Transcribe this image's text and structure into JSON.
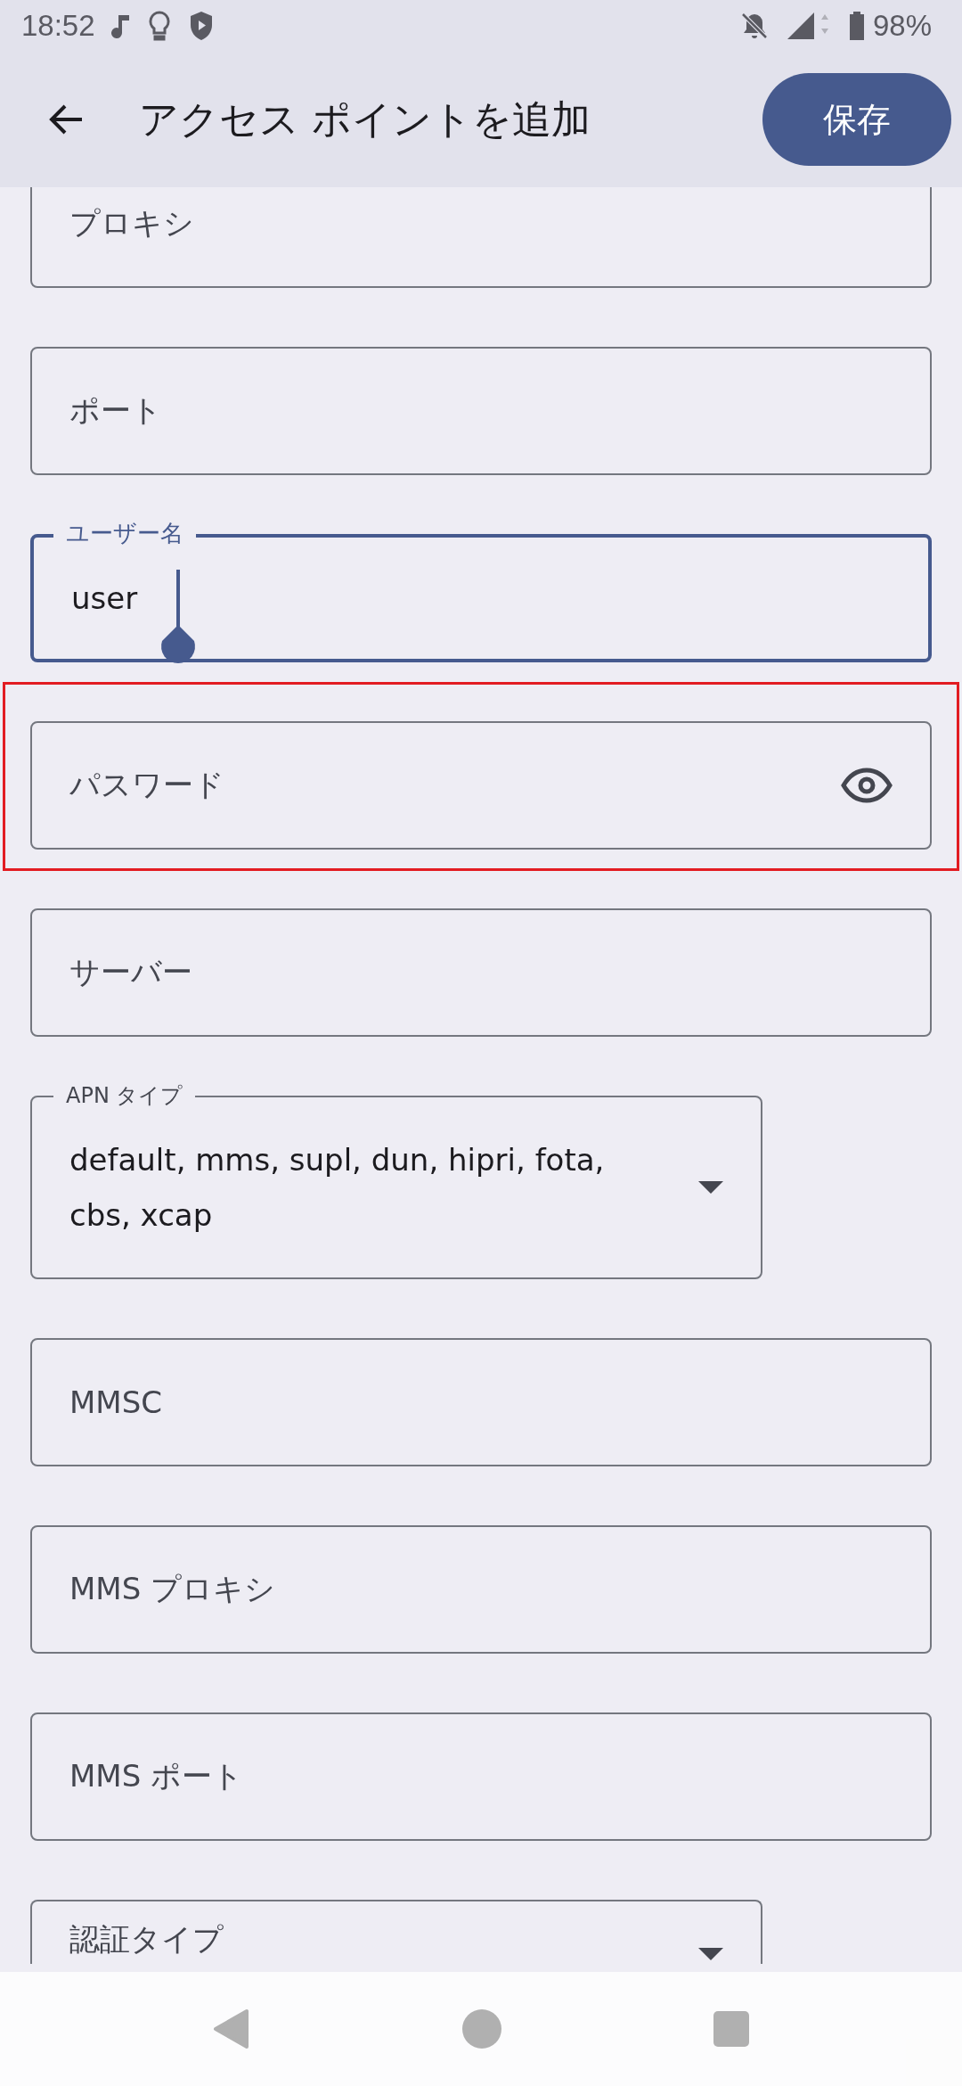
{
  "status_bar": {
    "time": "18:52",
    "battery": "98%"
  },
  "app_bar": {
    "title": "アクセス ポイントを追加",
    "save": "保存"
  },
  "fields": [
    {
      "kind": "text",
      "placeholder": "プロキシ",
      "focused": false,
      "highlighted": false
    },
    {
      "kind": "text",
      "placeholder": "ポート",
      "focused": false,
      "highlighted": false
    },
    {
      "kind": "text",
      "label": "ユーザー名",
      "value": "user",
      "focused": true,
      "highlighted": false
    },
    {
      "kind": "password",
      "placeholder": "パスワード",
      "focused": false,
      "highlighted": true
    },
    {
      "kind": "text",
      "placeholder": "サーバー",
      "focused": false,
      "highlighted": false
    },
    {
      "kind": "dropdown",
      "label": "APN タイプ",
      "value": "default, mms, supl, dun, hipri, fota, cbs, xcap",
      "focused": false,
      "highlighted": false
    },
    {
      "kind": "text",
      "placeholder": "MMSC",
      "focused": false,
      "highlighted": false
    },
    {
      "kind": "text",
      "placeholder": "MMS プロキシ",
      "focused": false,
      "highlighted": false
    },
    {
      "kind": "text",
      "placeholder": "MMS ポート",
      "focused": false,
      "highlighted": false
    },
    {
      "kind": "dropdown",
      "placeholder": "認証タイプ",
      "focused": false,
      "highlighted": false
    }
  ]
}
